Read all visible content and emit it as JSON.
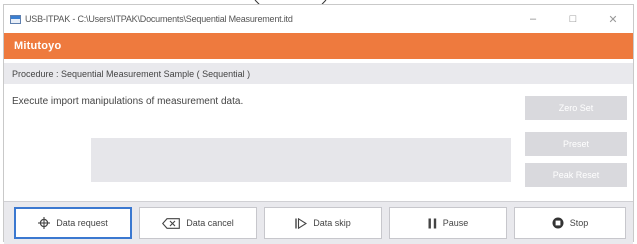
{
  "window": {
    "title": "USB-ITPAK - C:\\Users\\ITPAK\\Documents\\Sequential Measurement.itd",
    "minimize_glyph": "–",
    "maximize_glyph": "□",
    "close_glyph": "✕"
  },
  "brand": {
    "name": "Mitutoyo"
  },
  "procedure": {
    "text": "Procedure : Sequential Measurement Sample ( Sequential )"
  },
  "message": {
    "text": "Execute import manipulations of measurement data."
  },
  "side_buttons": {
    "zero_set": "Zero Set",
    "preset": "Preset",
    "peak_reset": "Peak Reset"
  },
  "footer": {
    "data_request": "Data request",
    "data_cancel": "Data cancel",
    "data_skip": "Data skip",
    "pause": "Pause",
    "stop": "Stop"
  },
  "icons": {
    "data_request": "crosshair-icon",
    "data_cancel": "backspace-icon",
    "data_skip": "skip-icon",
    "pause": "pause-icon",
    "stop": "stop-icon"
  },
  "colors": {
    "brand_bar": "#ee7a3e",
    "focus_border": "#3b78d0",
    "disabled_button": "#d9d9dd"
  }
}
